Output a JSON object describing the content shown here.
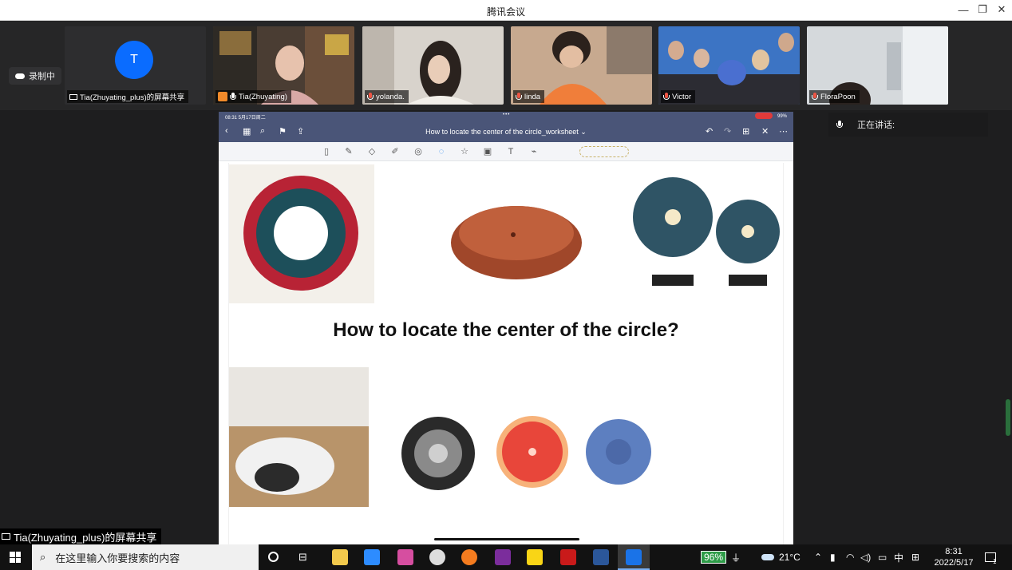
{
  "app": {
    "title": "腾讯会议"
  },
  "window_controls": {
    "minimize": "—",
    "maximize": "❐",
    "close": "✕"
  },
  "recording": {
    "label": "录制中"
  },
  "participants": [
    {
      "name": "Tia(Zhuyating_plus)的屏幕共享",
      "avatar_letter": "T",
      "type": "screen"
    },
    {
      "name": "Tia(Zhuyating)",
      "type": "host"
    },
    {
      "name": "yolanda.",
      "type": "video"
    },
    {
      "name": "linda",
      "type": "video"
    },
    {
      "name": "Victor",
      "type": "video"
    },
    {
      "name": "FloraPoon",
      "type": "video"
    }
  ],
  "speaking": {
    "label": "正在讲话:"
  },
  "ipad": {
    "status_time": "08:31  5月17日周二",
    "status_battery": "99%",
    "doc_title": "How to locate the center of the circle_worksheet ⌄",
    "question": "How to locate the center of the circle?"
  },
  "share_label": {
    "text": "Tia(Zhuyating_plus)的屏幕共享"
  },
  "taskbar": {
    "search_placeholder": "在这里输入你要搜索的内容",
    "battery": "96%",
    "weather": "21°C",
    "ime": "中",
    "time": "8:31",
    "date": "2022/5/17",
    "notification_count": "1"
  },
  "colors": {
    "accent": "#0a6cff",
    "ipad_nav": "#4a5578",
    "taskbar": "#121212"
  }
}
